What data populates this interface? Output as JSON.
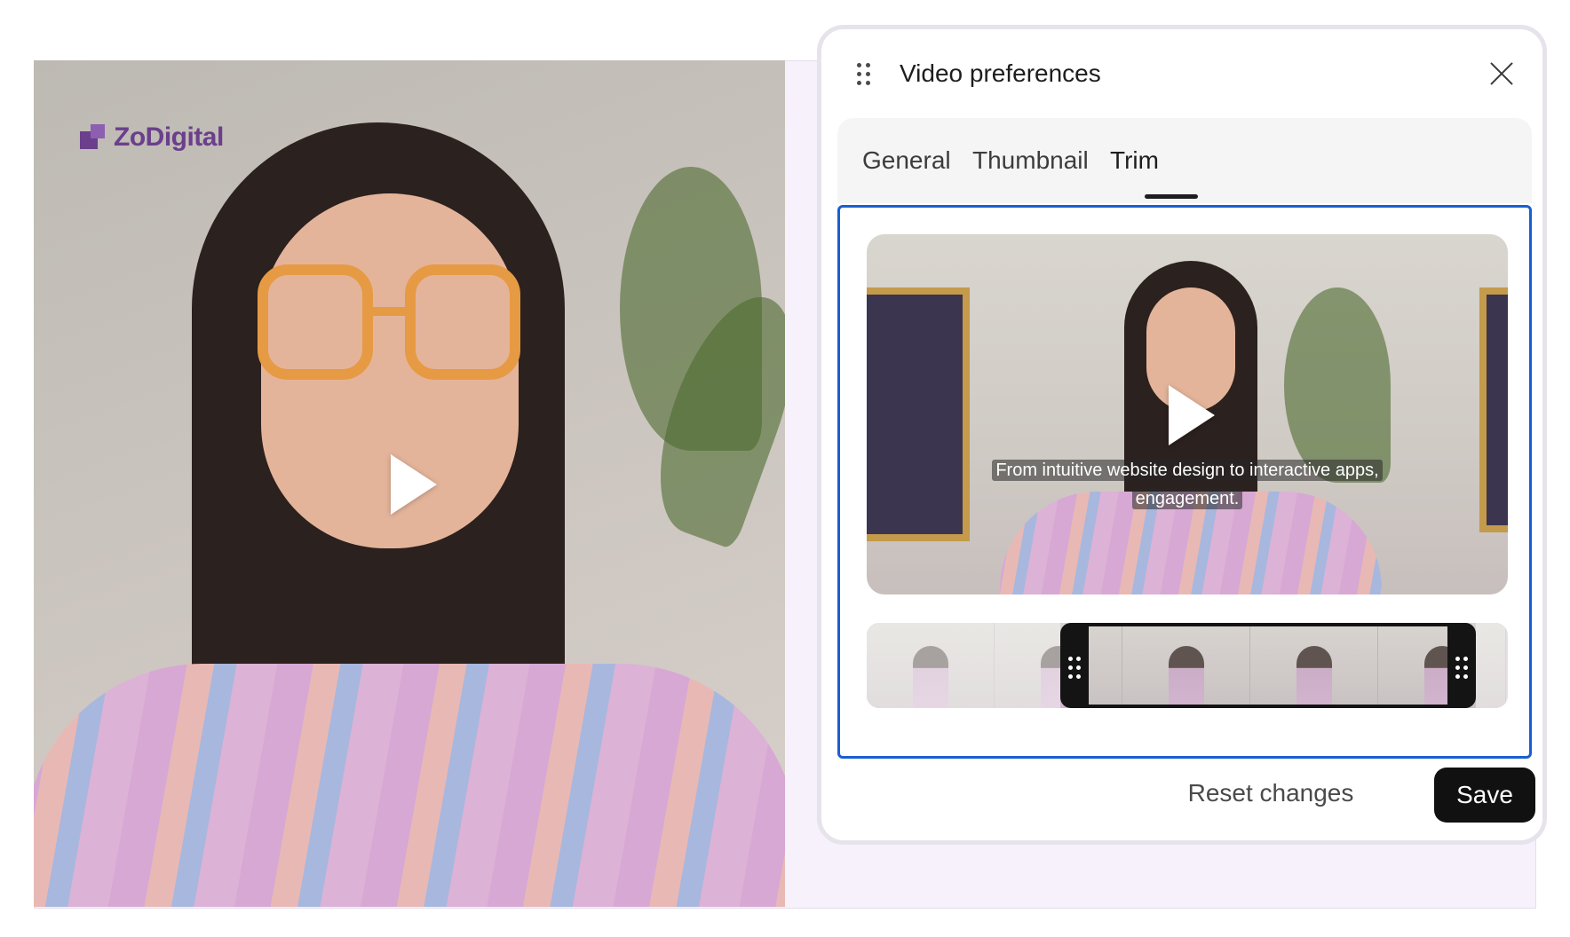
{
  "brand": {
    "name": "ZoDigital"
  },
  "panel": {
    "title": "Video preferences",
    "tabs": [
      {
        "label": "General",
        "active": false
      },
      {
        "label": "Thumbnail",
        "active": false
      },
      {
        "label": "Trim",
        "active": true
      }
    ],
    "preview": {
      "caption_line1": "From intuitive website design to interactive apps,",
      "caption_line2": "engagement."
    },
    "actions": {
      "reset_label": "Reset changes",
      "save_label": "Save"
    }
  },
  "icons": {
    "drag": "drag-handle-icon",
    "close": "close-icon",
    "play": "play-icon"
  },
  "colors": {
    "accent_border": "#1a5fd0",
    "save_bg": "#111111",
    "brand": "#6b3f8c",
    "stage_bg": "#f6f1fb"
  }
}
